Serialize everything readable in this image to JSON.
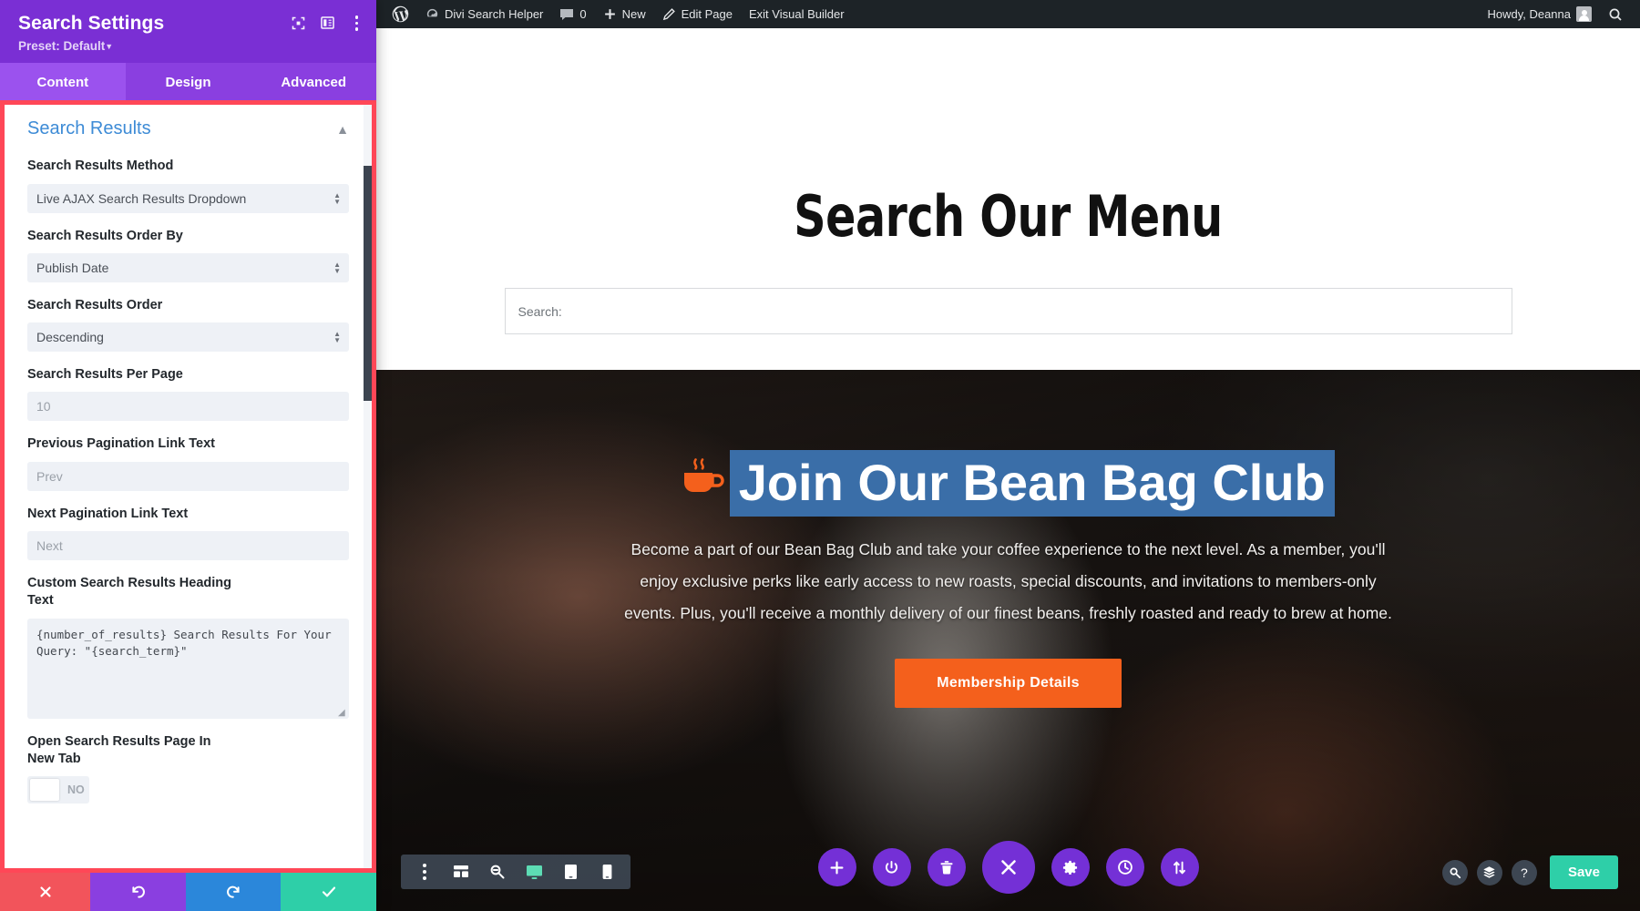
{
  "settings_panel": {
    "title": "Search Settings",
    "preset_label": "Preset: Default",
    "icons": {
      "fullscreen": "fullscreen-icon",
      "layout": "panel-layout-icon",
      "more": "kebab-menu-icon"
    },
    "tabs": [
      {
        "label": "Content",
        "active": true
      },
      {
        "label": "Design",
        "active": false
      },
      {
        "label": "Advanced",
        "active": false
      }
    ],
    "section": {
      "title": "Search Results",
      "collapse_icon": "chevron-up-icon"
    },
    "fields": {
      "method": {
        "label": "Search Results Method",
        "value": "Live AJAX Search Results Dropdown"
      },
      "order_by": {
        "label": "Search Results Order By",
        "value": "Publish Date"
      },
      "order": {
        "label": "Search Results Order",
        "value": "Descending"
      },
      "per_page": {
        "label": "Search Results Per Page",
        "placeholder": "10",
        "value": ""
      },
      "prev_text": {
        "label": "Previous Pagination Link Text",
        "placeholder": "Prev",
        "value": ""
      },
      "next_text": {
        "label": "Next Pagination Link Text",
        "placeholder": "Next",
        "value": ""
      },
      "heading_text": {
        "label": "Custom Search Results Heading Text",
        "value": "{number_of_results} Search Results For Your Query: \"{search_term}\""
      },
      "new_tab": {
        "label": "Open Search Results Page In New Tab",
        "toggle_value": "NO",
        "state": "off"
      }
    },
    "footer": [
      {
        "name": "cancel",
        "icon": "close-x-icon",
        "color": "#f2545b"
      },
      {
        "name": "undo",
        "icon": "undo-arrow-icon",
        "color": "#8a3fe0"
      },
      {
        "name": "redo",
        "icon": "redo-arrow-icon",
        "color": "#2b87da"
      },
      {
        "name": "save",
        "icon": "checkmark-icon",
        "color": "#2ecfa8"
      }
    ]
  },
  "admin_bar": {
    "logo": "wordpress-logo-icon",
    "site_name": "Divi Search Helper",
    "comments_count": "0",
    "new_label": "New",
    "edit_page_label": "Edit Page",
    "exit_builder_label": "Exit Visual Builder",
    "howdy": "Howdy, Deanna",
    "search_icon": "search-icon"
  },
  "page": {
    "heading": "Search Our Menu",
    "search_placeholder": "Search:",
    "hero": {
      "icon": "coffee-cup-icon",
      "heading": "Join Our Bean Bag Club",
      "paragraph": "Become a part of our Bean Bag Club and take your coffee experience to the next level. As a member, you'll enjoy exclusive perks like early access to new roasts, special discounts, and invitations to members-only events. Plus, you'll receive a monthly delivery of our finest beans, freshly roasted and ready to brew at home.",
      "cta_label": "Membership Details",
      "cta_color": "#f4601c"
    }
  },
  "builder": {
    "device_bar": [
      {
        "name": "kebab-menu-icon",
        "active": false
      },
      {
        "name": "wireframe-icon",
        "active": false
      },
      {
        "name": "zoom-out-icon",
        "active": false
      },
      {
        "name": "desktop-icon",
        "active": true
      },
      {
        "name": "tablet-icon",
        "active": false
      },
      {
        "name": "phone-icon",
        "active": false
      }
    ],
    "round_bar": [
      {
        "name": "add-icon",
        "big": false
      },
      {
        "name": "power-icon",
        "big": false
      },
      {
        "name": "trash-icon",
        "big": false
      },
      {
        "name": "close-x-icon",
        "big": true
      },
      {
        "name": "gear-icon",
        "big": false
      },
      {
        "name": "history-clock-icon",
        "big": false
      },
      {
        "name": "sort-arrows-icon",
        "big": false
      }
    ],
    "right_bar": {
      "icons": [
        "search-icon",
        "layers-icon",
        "help-icon"
      ],
      "save_label": "Save",
      "save_color": "#2ecfa8"
    }
  }
}
